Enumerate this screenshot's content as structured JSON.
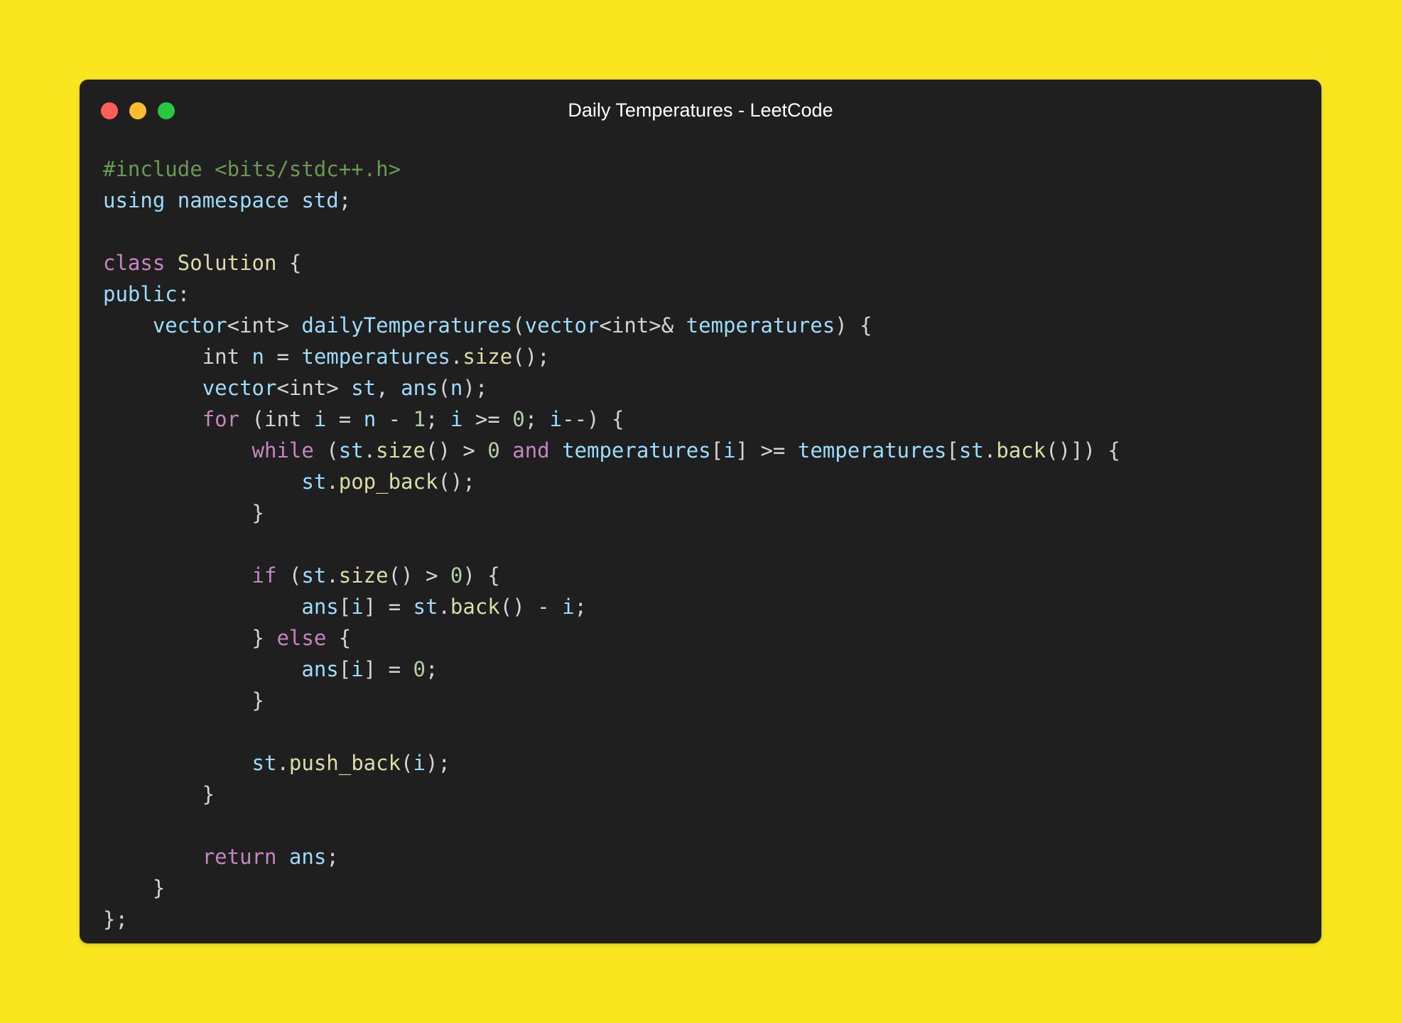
{
  "window": {
    "title": "Daily Temperatures - LeetCode"
  },
  "colors": {
    "background": "#F9E61E",
    "window": "#1F1F1F",
    "light_red": "#FF5F57",
    "light_yellow": "#FEBC2E",
    "light_green": "#28C840",
    "comment": "#6A9955",
    "keyword": "#C586C0",
    "variable": "#9CDCFE",
    "function": "#DCDCAA",
    "number": "#B5CEA8",
    "plain": "#D4D4D4"
  },
  "code": {
    "lines": [
      [
        [
          "c",
          "#include <bits/stdc++.h>"
        ]
      ],
      [
        [
          "v",
          "using namespace std"
        ],
        [
          "p",
          ";"
        ]
      ],
      [],
      [
        [
          "k",
          "class "
        ],
        [
          "f",
          "Solution"
        ],
        [
          "p",
          " {"
        ]
      ],
      [
        [
          "v",
          "public"
        ],
        [
          "p",
          ":"
        ]
      ],
      [
        [
          "p",
          "    "
        ],
        [
          "v",
          "vector"
        ],
        [
          "p",
          "<int> "
        ],
        [
          "v",
          "dailyTemperatures"
        ],
        [
          "p",
          "("
        ],
        [
          "v",
          "vector"
        ],
        [
          "p",
          "<int>& "
        ],
        [
          "v",
          "temperatures"
        ],
        [
          "p",
          ") {"
        ]
      ],
      [
        [
          "p",
          "        int "
        ],
        [
          "v",
          "n"
        ],
        [
          "p",
          " = "
        ],
        [
          "v",
          "temperatures"
        ],
        [
          "p",
          "."
        ],
        [
          "f",
          "size"
        ],
        [
          "p",
          "();"
        ]
      ],
      [
        [
          "p",
          "        "
        ],
        [
          "v",
          "vector"
        ],
        [
          "p",
          "<int> "
        ],
        [
          "v",
          "st"
        ],
        [
          "p",
          ", "
        ],
        [
          "v",
          "ans"
        ],
        [
          "p",
          "("
        ],
        [
          "v",
          "n"
        ],
        [
          "p",
          ");"
        ]
      ],
      [
        [
          "p",
          "        "
        ],
        [
          "k",
          "for"
        ],
        [
          "p",
          " (int "
        ],
        [
          "v",
          "i"
        ],
        [
          "p",
          " = "
        ],
        [
          "v",
          "n"
        ],
        [
          "p",
          " - "
        ],
        [
          "n",
          "1"
        ],
        [
          "p",
          "; "
        ],
        [
          "v",
          "i"
        ],
        [
          "p",
          " >= "
        ],
        [
          "n",
          "0"
        ],
        [
          "p",
          "; "
        ],
        [
          "v",
          "i"
        ],
        [
          "p",
          "--) {"
        ]
      ],
      [
        [
          "p",
          "            "
        ],
        [
          "k",
          "while"
        ],
        [
          "p",
          " ("
        ],
        [
          "v",
          "st"
        ],
        [
          "p",
          "."
        ],
        [
          "f",
          "size"
        ],
        [
          "p",
          "() > "
        ],
        [
          "n",
          "0"
        ],
        [
          "p",
          " "
        ],
        [
          "k",
          "and"
        ],
        [
          "p",
          " "
        ],
        [
          "v",
          "temperatures"
        ],
        [
          "p",
          "["
        ],
        [
          "v",
          "i"
        ],
        [
          "p",
          "] >= "
        ],
        [
          "v",
          "temperatures"
        ],
        [
          "p",
          "["
        ],
        [
          "v",
          "st"
        ],
        [
          "p",
          "."
        ],
        [
          "f",
          "back"
        ],
        [
          "p",
          "()]) {"
        ]
      ],
      [
        [
          "p",
          "                "
        ],
        [
          "v",
          "st"
        ],
        [
          "p",
          "."
        ],
        [
          "f",
          "pop_back"
        ],
        [
          "p",
          "();"
        ]
      ],
      [
        [
          "p",
          "            }"
        ]
      ],
      [],
      [
        [
          "p",
          "            "
        ],
        [
          "k",
          "if"
        ],
        [
          "p",
          " ("
        ],
        [
          "v",
          "st"
        ],
        [
          "p",
          "."
        ],
        [
          "f",
          "size"
        ],
        [
          "p",
          "() > "
        ],
        [
          "n",
          "0"
        ],
        [
          "p",
          ") {"
        ]
      ],
      [
        [
          "p",
          "                "
        ],
        [
          "v",
          "ans"
        ],
        [
          "p",
          "["
        ],
        [
          "v",
          "i"
        ],
        [
          "p",
          "] = "
        ],
        [
          "v",
          "st"
        ],
        [
          "p",
          "."
        ],
        [
          "f",
          "back"
        ],
        [
          "p",
          "() - "
        ],
        [
          "v",
          "i"
        ],
        [
          "p",
          ";"
        ]
      ],
      [
        [
          "p",
          "            } "
        ],
        [
          "k",
          "else"
        ],
        [
          "p",
          " {"
        ]
      ],
      [
        [
          "p",
          "                "
        ],
        [
          "v",
          "ans"
        ],
        [
          "p",
          "["
        ],
        [
          "v",
          "i"
        ],
        [
          "p",
          "] = "
        ],
        [
          "n",
          "0"
        ],
        [
          "p",
          ";"
        ]
      ],
      [
        [
          "p",
          "            }"
        ]
      ],
      [],
      [
        [
          "p",
          "            "
        ],
        [
          "v",
          "st"
        ],
        [
          "p",
          "."
        ],
        [
          "f",
          "push_back"
        ],
        [
          "p",
          "("
        ],
        [
          "v",
          "i"
        ],
        [
          "p",
          ");"
        ]
      ],
      [
        [
          "p",
          "        }"
        ]
      ],
      [],
      [
        [
          "p",
          "        "
        ],
        [
          "k",
          "return"
        ],
        [
          "p",
          " "
        ],
        [
          "v",
          "ans"
        ],
        [
          "p",
          ";"
        ]
      ],
      [
        [
          "p",
          "    }"
        ]
      ],
      [
        [
          "p",
          "};"
        ]
      ]
    ]
  }
}
